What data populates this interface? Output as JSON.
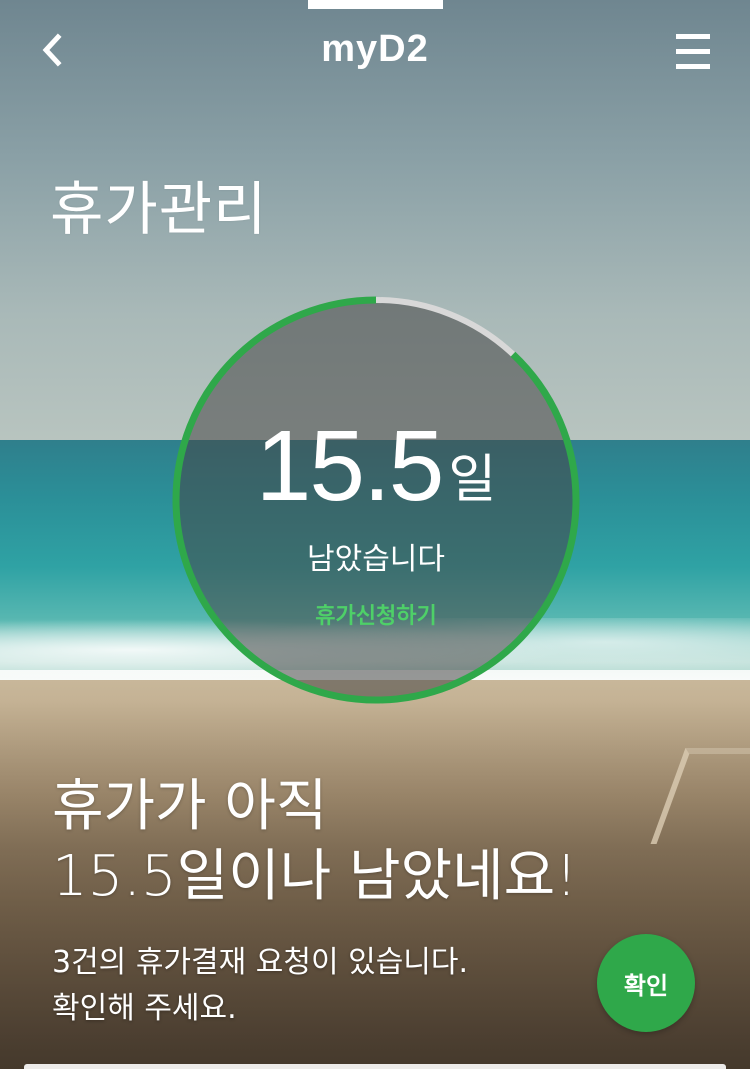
{
  "header": {
    "logo_text": "myD2",
    "back_icon": "chevron-left-icon",
    "menu_icon": "hamburger-menu-icon"
  },
  "page": {
    "title": "휴가관리"
  },
  "leave_status": {
    "days_remaining": "15.5",
    "days_unit": "일",
    "remaining_label": "남았습니다",
    "apply_link": "휴가신청하기",
    "progress_used_fraction": 0.12
  },
  "message": {
    "line1": "휴가가 아직",
    "line2": "15.5일이나 남았네요!",
    "sub_line1": "3건의 휴가결재 요청이 있습니다.",
    "sub_line2": "확인해 주세요.",
    "confirm_label": "확인"
  },
  "colors": {
    "accent": "#2fa84a",
    "accent_text": "#4ed068",
    "ring_track": "#d8d8d8",
    "circle_fill": "rgba(60,60,60,0.55)"
  }
}
